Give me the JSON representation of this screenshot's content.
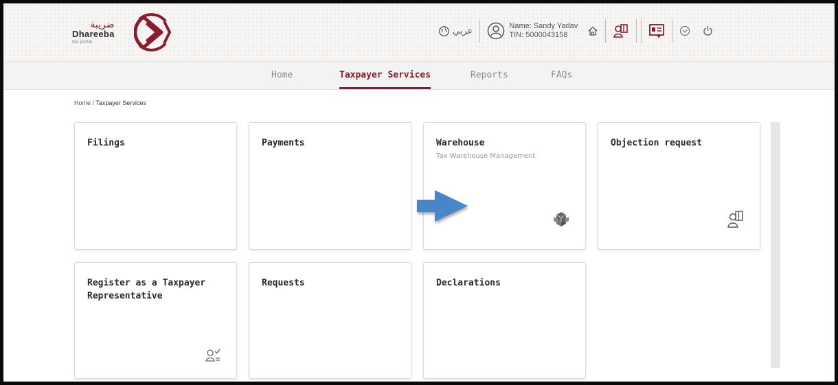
{
  "logo": {
    "arabic": "ضريبة",
    "name": "Dhareeba",
    "subtitle": "tax portal",
    "brand_color": "#8a1c2b"
  },
  "header": {
    "language_label": "عربي",
    "user_name": "Name: Sandy Yadav",
    "user_tin": "TIN: 5000043158",
    "icons": [
      "globe-icon",
      "user-circle-icon",
      "home-icon",
      "taxpayer-representative-icon",
      "id-card-icon",
      "chevron-down-icon",
      "power-icon"
    ]
  },
  "nav": {
    "items": [
      {
        "label": "Home",
        "active": false
      },
      {
        "label": "Taxpayer Services",
        "active": true
      },
      {
        "label": "Reports",
        "active": false
      },
      {
        "label": "FAQs",
        "active": false
      }
    ]
  },
  "breadcrumb": {
    "home": "Home",
    "separator": " / ",
    "current": "Taxpayer Services"
  },
  "cards": [
    {
      "title": "Filings",
      "subtitle": "",
      "icon": ""
    },
    {
      "title": "Payments",
      "subtitle": "",
      "icon": ""
    },
    {
      "title": "Warehouse",
      "subtitle": "Tax Warehouse Management",
      "icon": "warehouse-cubes-icon"
    },
    {
      "title": "Objection request",
      "subtitle": "",
      "icon": "objection-request-icon"
    },
    {
      "title": "Register as a Taxpayer Representative",
      "subtitle": "",
      "icon": "user-check-icon"
    },
    {
      "title": "Requests",
      "subtitle": "",
      "icon": ""
    },
    {
      "title": "Declarations",
      "subtitle": "",
      "icon": ""
    }
  ],
  "colors": {
    "accent": "#8a1c2b",
    "arrow": "#4a86c8"
  }
}
